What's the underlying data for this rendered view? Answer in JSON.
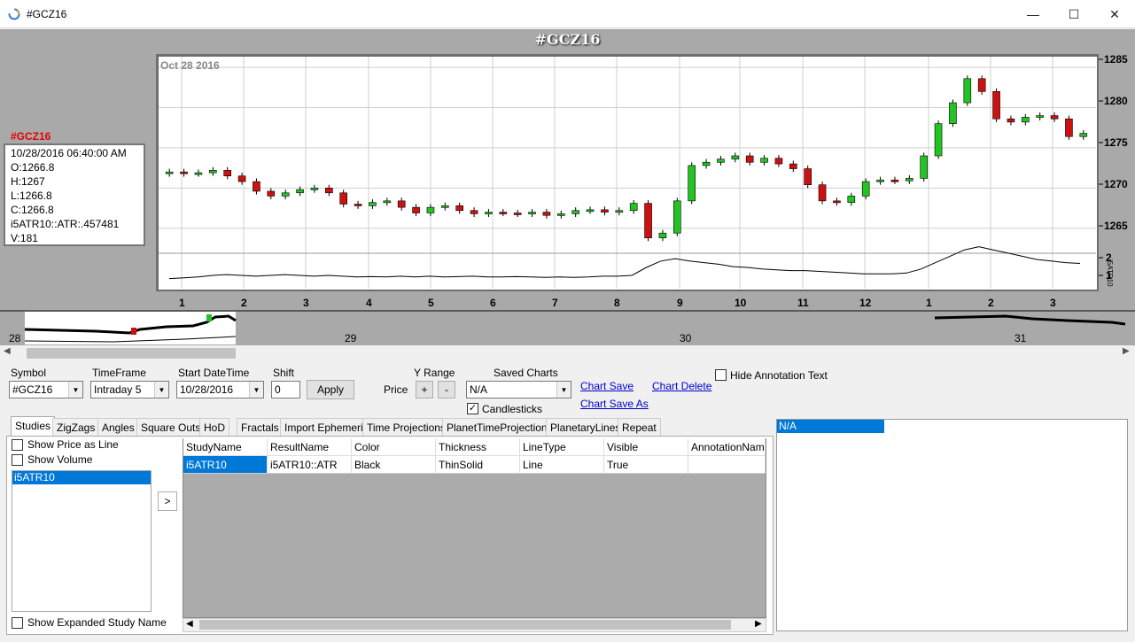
{
  "window": {
    "title": "#GCZ16",
    "minimize": "—",
    "maximize": "☐",
    "close": "✕"
  },
  "chart": {
    "header": "#GCZ16",
    "date_label": "Oct 28 2016",
    "info": {
      "symbol": "#GCZ16",
      "lines": [
        "10/28/2016 06:40:00 AM",
        "O:1266.8",
        "H:1267",
        "L:1266.8",
        "C:1266.8",
        "i5ATR10::ATR:.457481",
        "V:181"
      ]
    },
    "price_ticks": [
      "1285",
      "1280",
      "1275",
      "1270",
      "1265"
    ],
    "atr_ticks": [
      "2",
      "1"
    ],
    "atr_label": "i5ATR10",
    "x_ticks": [
      "1",
      "2",
      "3",
      "4",
      "5",
      "6",
      "7",
      "8",
      "9",
      "10",
      "11",
      "12",
      "1",
      "2",
      "3"
    ],
    "overview_labels": [
      "28",
      "29",
      "30",
      "31"
    ],
    "colors": {
      "up": "#22c322",
      "down": "#cc1111",
      "panel": "#a9a9a9"
    }
  },
  "chart_data": {
    "type": "candlestick",
    "title": "#GCZ16",
    "x_tick_labels": [
      "1",
      "2",
      "3",
      "4",
      "5",
      "6",
      "7",
      "8",
      "9",
      "10",
      "11",
      "12",
      "1",
      "2",
      "3"
    ],
    "ylim": [
      1262,
      1286
    ],
    "close_path": [
      1272.0,
      1271.8,
      1271.9,
      1272.2,
      1271.5,
      1270.8,
      1269.6,
      1269.0,
      1269.4,
      1269.8,
      1270.0,
      1269.4,
      1268.0,
      1267.8,
      1268.2,
      1268.4,
      1267.6,
      1266.9,
      1267.6,
      1267.8,
      1267.2,
      1266.8,
      1267.0,
      1266.9,
      1266.8,
      1267.0,
      1266.6,
      1266.8,
      1267.2,
      1267.3,
      1267.0,
      1267.2,
      1268.1,
      1263.8,
      1264.4,
      1268.4,
      1272.8,
      1273.2,
      1273.6,
      1274.0,
      1273.2,
      1273.7,
      1273.0,
      1272.4,
      1270.4,
      1268.4,
      1268.2,
      1269.0,
      1270.8,
      1271.0,
      1270.9,
      1271.2,
      1274.0,
      1278.0,
      1280.6,
      1283.6,
      1282.0,
      1278.6,
      1278.2,
      1278.8,
      1279.0,
      1278.6,
      1276.4,
      1276.8
    ],
    "atr": [
      0.3,
      0.35,
      0.4,
      0.5,
      0.55,
      0.5,
      0.45,
      0.5,
      0.55,
      0.5,
      0.45,
      0.5,
      0.45,
      0.4,
      0.42,
      0.4,
      0.45,
      0.4,
      0.45,
      0.4,
      0.42,
      0.45,
      0.4,
      0.4,
      0.42,
      0.4,
      0.38,
      0.4,
      0.38,
      0.4,
      0.45,
      0.45,
      0.5,
      1.0,
      1.4,
      1.55,
      1.4,
      1.3,
      1.2,
      1.05,
      1.0,
      0.9,
      0.85,
      0.8,
      0.8,
      0.75,
      0.7,
      0.65,
      0.6,
      0.6,
      0.6,
      0.65,
      0.9,
      1.3,
      1.7,
      2.1,
      2.3,
      2.1,
      1.9,
      1.7,
      1.5,
      1.4,
      1.3,
      1.25
    ]
  },
  "form": {
    "symbol_label": "Symbol",
    "symbol_value": "#GCZ16",
    "timeframe_label": "TimeFrame",
    "timeframe_value": "Intraday 5",
    "start_label": "Start DateTime",
    "start_value": "10/28/2016",
    "shift_label": "Shift",
    "shift_value": "0",
    "apply": "Apply",
    "price_label": "Price",
    "yrange_label": "Y Range",
    "plus": "+",
    "minus": "-",
    "saved_label": "Saved Charts",
    "saved_value": "N/A",
    "chart_save": "Chart Save",
    "chart_delete": "Chart Delete",
    "chart_save_as": "Chart Save As",
    "candlesticks": "Candlesticks",
    "hide_annotation": "Hide Annotation Text"
  },
  "tabs": [
    "Studies",
    "ZigZags",
    "Angles",
    "Square Outs",
    "HoD",
    "Fractals",
    "Import Ephemeris",
    "Time Projections",
    "PlanetTimeProjections",
    "PlanetaryLines",
    "Repeat"
  ],
  "studies": {
    "show_price_line": "Show Price as Line",
    "show_volume": "Show Volume",
    "list": [
      "i5ATR10"
    ],
    "move_button": ">",
    "show_expanded": "Show Expanded Study Name",
    "columns": [
      "StudyName",
      "ResultName",
      "Color",
      "Thickness",
      "LineType",
      "Visible",
      "AnnotationName"
    ],
    "rows": [
      [
        "i5ATR10",
        "i5ATR10::ATR",
        "Black",
        "ThinSolid",
        "Line",
        "True",
        ""
      ]
    ]
  },
  "annotations": [
    "N/A"
  ]
}
